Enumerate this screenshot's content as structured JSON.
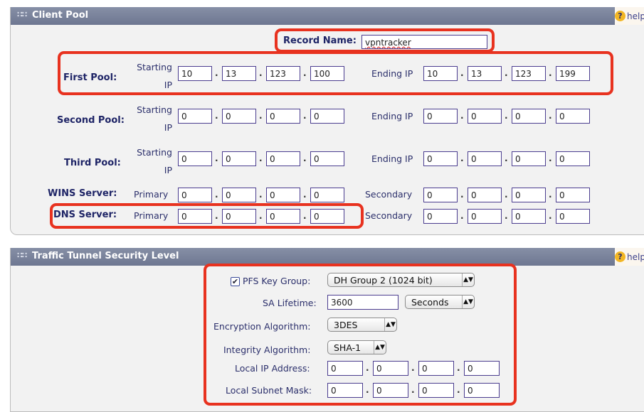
{
  "client_pool": {
    "title": "Client Pool",
    "help_label": "help",
    "record_name": {
      "label": "Record Name:",
      "value": "vpntracker"
    },
    "starting_ip_label": "Starting IP",
    "ending_ip_label": "Ending IP",
    "pools": [
      {
        "label": "First Pool:",
        "start": [
          "10",
          "13",
          "123",
          "100"
        ],
        "end": [
          "10",
          "13",
          "123",
          "199"
        ]
      },
      {
        "label": "Second Pool:",
        "start": [
          "0",
          "0",
          "0",
          "0"
        ],
        "end": [
          "0",
          "0",
          "0",
          "0"
        ]
      },
      {
        "label": "Third Pool:",
        "start": [
          "0",
          "0",
          "0",
          "0"
        ],
        "end": [
          "0",
          "0",
          "0",
          "0"
        ]
      }
    ],
    "wins": {
      "label": "WINS Server:",
      "primary_label": "Primary",
      "secondary_label": "Secondary",
      "primary": [
        "0",
        "0",
        "0",
        "0"
      ],
      "secondary": [
        "0",
        "0",
        "0",
        "0"
      ]
    },
    "dns": {
      "label": "DNS Server:",
      "primary_label": "Primary",
      "secondary_label": "Secondary",
      "primary": [
        "0",
        "0",
        "0",
        "0"
      ],
      "secondary": [
        "0",
        "0",
        "0",
        "0"
      ]
    }
  },
  "traffic_tunnel": {
    "title": "Traffic Tunnel Security Level",
    "help_label": "help",
    "pfs_key_group": {
      "label": "PFS Key Group:",
      "checked": true,
      "value": "DH Group 2 (1024 bit)"
    },
    "sa_lifetime": {
      "label": "SA Lifetime:",
      "value": "3600",
      "unit": "Seconds"
    },
    "encryption": {
      "label": "Encryption Algorithm:",
      "value": "3DES"
    },
    "integrity": {
      "label": "Integrity Algorithm:",
      "value": "SHA-1"
    },
    "local_ip": {
      "label": "Local IP Address:",
      "octets": [
        "0",
        "0",
        "0",
        "0"
      ]
    },
    "local_mask": {
      "label": "Local Subnet Mask:",
      "octets": [
        "0",
        "0",
        "0",
        "0"
      ]
    }
  },
  "icons": {
    "grip": "grip-icon",
    "help": "help-icon",
    "checkbox": "checkmark-icon",
    "dropdown": "updown-arrow-icon"
  },
  "colors": {
    "header": "#7a829b",
    "highlight": "#e8321f",
    "panel": "#f2f2f2",
    "field_border": "#4b3d8f"
  }
}
